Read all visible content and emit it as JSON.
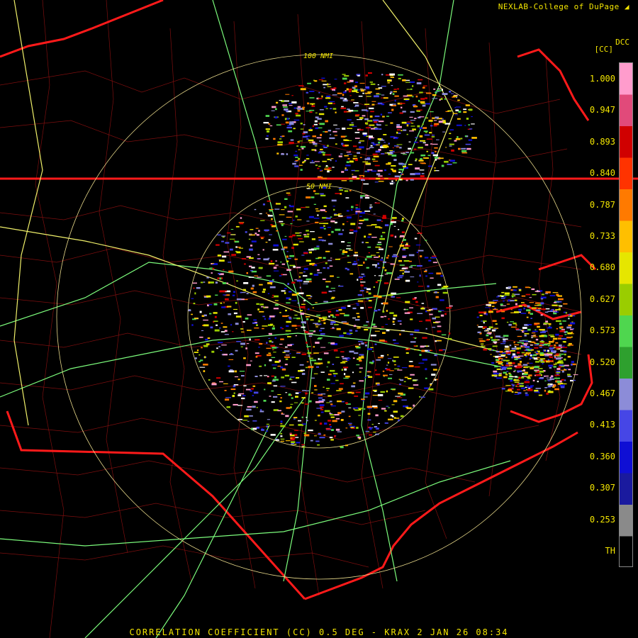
{
  "header": {
    "credit": "NEXLAB-College of DuPage",
    "logo_icon": "cod-logo-icon"
  },
  "legend": {
    "product_code": "DCC",
    "unit": "[CC]",
    "ticks": [
      "1.000",
      "0.947",
      "0.893",
      "0.840",
      "0.787",
      "0.733",
      "0.680",
      "0.627",
      "0.573",
      "0.520",
      "0.467",
      "0.413",
      "0.360",
      "0.307",
      "0.253",
      "TH"
    ],
    "colors": [
      "#ff9ccc",
      "#e14a7a",
      "#d00000",
      "#ff3300",
      "#ff7a00",
      "#ffbf00",
      "#e6e600",
      "#9acd00",
      "#4fd64f",
      "#2ea02e",
      "#8c8cd8",
      "#4646e6",
      "#0f0fd4",
      "#1a1a9e",
      "#8a8a8a",
      "#000000"
    ]
  },
  "range_rings": {
    "inner_label": "50 NMI",
    "outer_label": "100 NMI"
  },
  "footer": {
    "title": "CORRELATION COEFFICIENT (CC) 0.5 DEG - KRAX 2 JAN 26 08:34"
  }
}
